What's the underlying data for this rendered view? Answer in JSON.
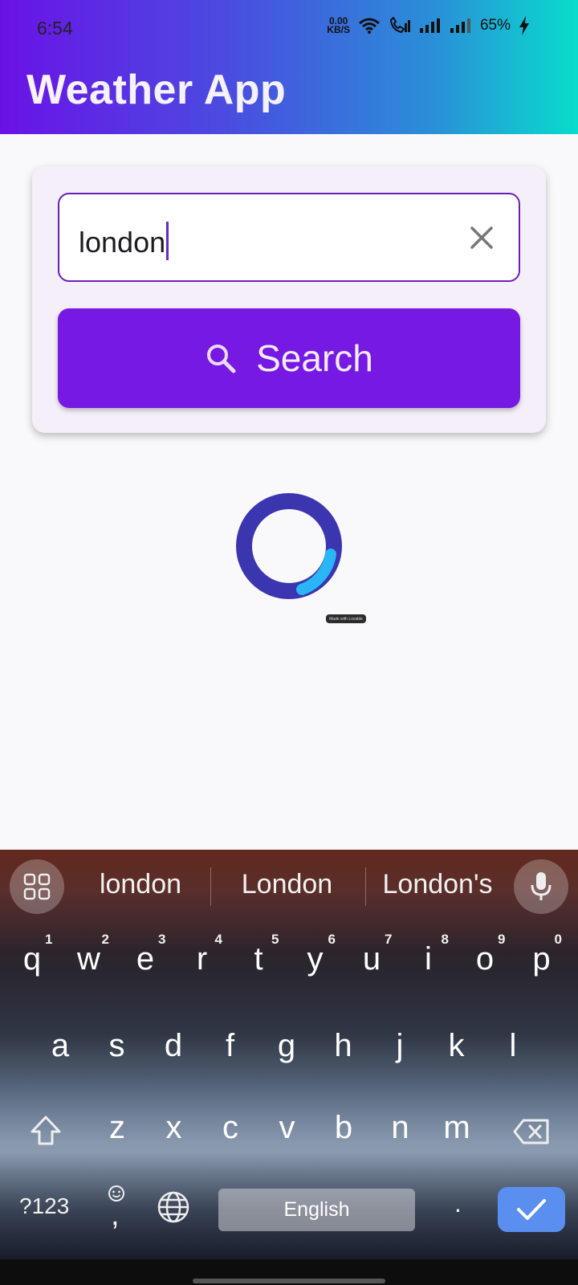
{
  "status_bar": {
    "time": "6:54",
    "net_speed_value": "0.00",
    "net_speed_unit": "KB/S",
    "battery": "65%"
  },
  "app": {
    "title": "Weather App"
  },
  "search": {
    "input_value": "london",
    "button_label": "Search"
  },
  "badge": {
    "text": "Made with Lovable"
  },
  "keyboard": {
    "suggestions": [
      "london",
      "London",
      "London's"
    ],
    "row1": [
      {
        "k": "q",
        "h": "1"
      },
      {
        "k": "w",
        "h": "2"
      },
      {
        "k": "e",
        "h": "3"
      },
      {
        "k": "r",
        "h": "4"
      },
      {
        "k": "t",
        "h": "5"
      },
      {
        "k": "y",
        "h": "6"
      },
      {
        "k": "u",
        "h": "7"
      },
      {
        "k": "i",
        "h": "8"
      },
      {
        "k": "o",
        "h": "9"
      },
      {
        "k": "p",
        "h": "0"
      }
    ],
    "row2": [
      "a",
      "s",
      "d",
      "f",
      "g",
      "h",
      "j",
      "k",
      "l"
    ],
    "row3": [
      "z",
      "x",
      "c",
      "v",
      "b",
      "n",
      "m"
    ],
    "symbols_label": "?123",
    "comma": ",",
    "period": ".",
    "space_label": "English"
  },
  "colors": {
    "accent": "#7619e2",
    "input_border": "#6c1fb8",
    "loader_ring": "#3b36b0",
    "loader_arc": "#29b6f6",
    "enter_key": "#5a8ff0"
  },
  "icons": {
    "clear": "close-icon",
    "search": "search-icon",
    "keyboard_menu": "grid-icon",
    "voice": "mic-icon",
    "shift": "shift-icon",
    "backspace": "backspace-icon",
    "emoji": "emoji-icon",
    "language": "globe-icon",
    "enter": "check-icon"
  }
}
